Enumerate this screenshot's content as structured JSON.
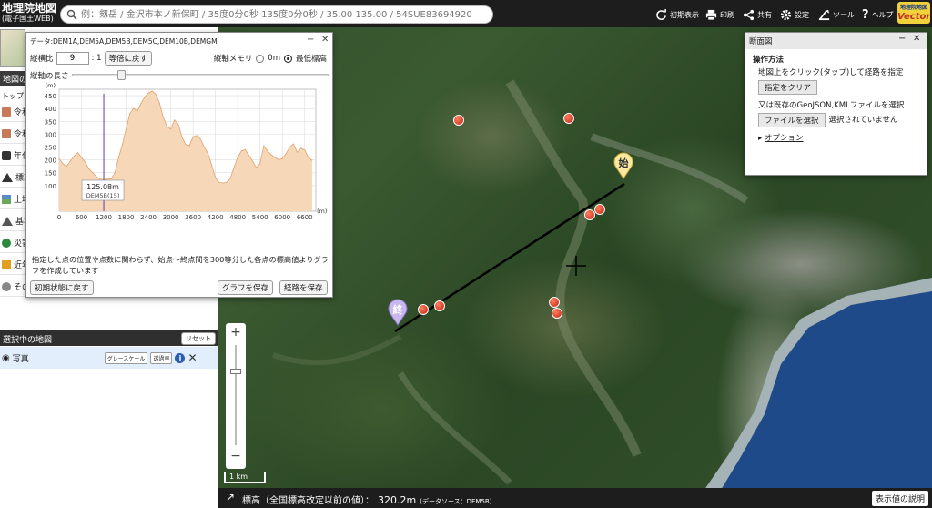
{
  "app": {
    "title_line1": "地理院地図",
    "title_line2": "(電子国土WEB)"
  },
  "search": {
    "placeholder": "例：剱岳 / 金沢市本ノ新保町 / 35度0分0秒 135度0分0秒 / 35.00 135.00 / 54SUE83694920"
  },
  "toolbar": {
    "initial_view": "初期表示",
    "print": "印刷",
    "share": "共有",
    "settings": "設定",
    "tools": "ツール",
    "help": "ヘルプ",
    "vector_top": "地理院地図",
    "vector_bottom": "Vector"
  },
  "left_panel": {
    "header": "地図の",
    "top_link": "トップ",
    "items": [
      {
        "label": "令和",
        "icon": "folder-icon"
      },
      {
        "label": "令和",
        "icon": "folder-icon"
      },
      {
        "label": "年代",
        "icon": "camera-icon"
      },
      {
        "label": "標高",
        "icon": "mountain-icon"
      },
      {
        "label": "土地",
        "icon": "land-icon"
      },
      {
        "label": "基準",
        "icon": "triangle-icon"
      },
      {
        "label": "災害",
        "icon": "person-icon"
      },
      {
        "label": "近年",
        "icon": "photo-icon"
      },
      {
        "label": "その",
        "icon": "globe-icon"
      }
    ],
    "selected_header": "選択中の地図",
    "reset": "リセット",
    "selected_layer": "写真",
    "grayscale": "グレースケール",
    "transparency": "透過率",
    "info": "i"
  },
  "graph_dialog": {
    "title": "データ:DEM1A,DEM5A,DEM5B,DEM5C,DEM10B,DEMGM",
    "ratio_label": "縦横比",
    "ratio_value": "9",
    "ratio_suffix": ": 1",
    "reset_ratio": "等倍に戻す",
    "axis_label": "縦軸メモリ",
    "axis_opt1": "0m",
    "axis_opt2": "最低標高",
    "axis_selected": "最低標高",
    "length_label": "縦軸の長さ",
    "tooltip_value": "125.08m",
    "tooltip_source": "DEM5B(15)",
    "note": "指定した点の位置や点数に関わらず、始点～終点間を300等分した各点の標高値よりグラフを作成しています",
    "reset_button": "初期状態に戻す",
    "save_graph": "グラフを保存",
    "save_route": "経路を保存"
  },
  "chart_data": {
    "type": "area",
    "title": "",
    "xlabel": "(m)",
    "ylabel": "(m)",
    "xlim": [
      0,
      6900
    ],
    "ylim": [
      0,
      475
    ],
    "x_ticks": [
      0,
      600,
      1200,
      1800,
      2400,
      3000,
      3600,
      4200,
      4800,
      5400,
      6000,
      6600
    ],
    "y_ticks": [
      100,
      150,
      200,
      250,
      300,
      350,
      400,
      450
    ],
    "x": [
      0,
      100,
      200,
      300,
      400,
      500,
      600,
      700,
      800,
      900,
      1000,
      1100,
      1200,
      1300,
      1400,
      1500,
      1600,
      1700,
      1800,
      1900,
      2000,
      2100,
      2200,
      2300,
      2400,
      2500,
      2600,
      2700,
      2800,
      2900,
      3000,
      3100,
      3200,
      3300,
      3400,
      3500,
      3600,
      3700,
      3800,
      3900,
      4000,
      4100,
      4200,
      4300,
      4400,
      4500,
      4600,
      4700,
      4800,
      4900,
      5000,
      5100,
      5200,
      5300,
      5400,
      5500,
      5600,
      5700,
      5800,
      5900,
      6000,
      6100,
      6200,
      6300,
      6400,
      6500,
      6600,
      6700,
      6800
    ],
    "values": [
      205,
      185,
      175,
      195,
      215,
      228,
      210,
      190,
      165,
      150,
      135,
      125,
      124,
      125,
      126,
      150,
      210,
      260,
      320,
      380,
      400,
      390,
      420,
      445,
      460,
      468,
      455,
      420,
      365,
      330,
      320,
      355,
      340,
      290,
      260,
      255,
      290,
      295,
      280,
      250,
      225,
      180,
      130,
      112,
      110,
      112,
      128,
      170,
      210,
      235,
      240,
      218,
      195,
      170,
      185,
      255,
      235,
      220,
      210,
      200,
      205,
      225,
      250,
      262,
      230,
      245,
      238,
      210,
      198
    ],
    "fill_color": "#f6d7b8",
    "line_color": "#e2a16a",
    "marker_x": 1200,
    "grid": true
  },
  "profile_panel": {
    "title": "断面図",
    "heading": "操作方法",
    "line1": "地図上をクリック(タップ)して経路を指定",
    "clear_button": "指定をクリア",
    "line2": "又は既存のGeoJSON,KMLファイルを選択",
    "file_button": "ファイルを選択",
    "file_status": "選択されていません",
    "option": "オプション"
  },
  "map": {
    "start_marker": "始",
    "end_marker": "終",
    "scale": "1 km",
    "zoom_in": "+",
    "zoom_out": "−"
  },
  "bottom_bar": {
    "label": "標高（全国標高改定以前の値）：",
    "value": "320.2m",
    "source": "(データソース：DEM5B)",
    "explain": "表示値の説明"
  }
}
